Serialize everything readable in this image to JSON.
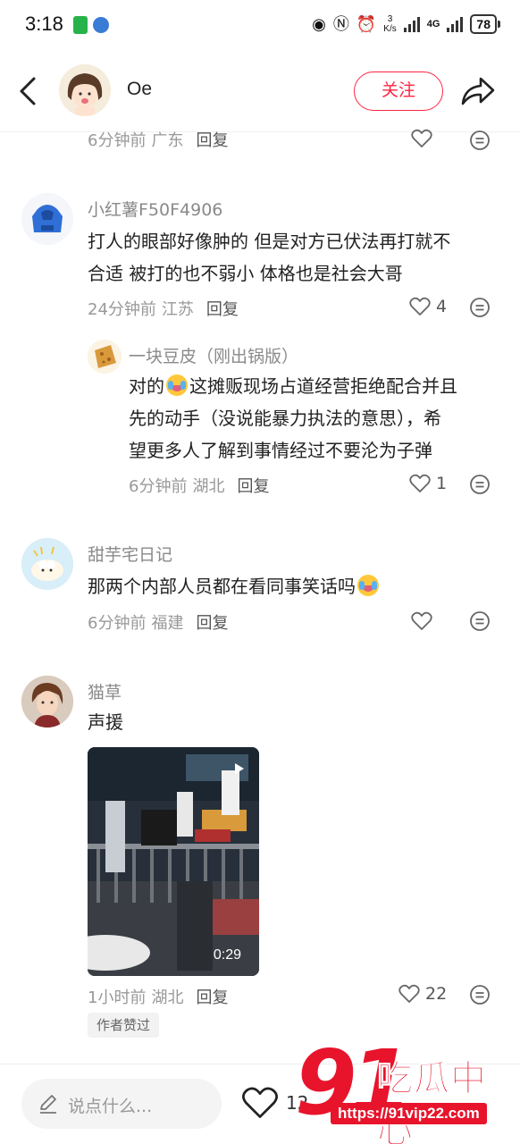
{
  "status_bar": {
    "time": "3:18",
    "net_speed_value": "3",
    "net_speed_unit": "K/s",
    "network": "4G",
    "battery": "78"
  },
  "header": {
    "name": "Oe",
    "follow_label": "关注"
  },
  "comments": [
    {
      "meta_time": "6分钟前",
      "meta_location": "广东",
      "reply_label": "回复",
      "likes": ""
    },
    {
      "username": "小红薯F50F4906",
      "content_line1": "打人的眼部好像肿的  但是对方已伏法再打就不",
      "content_line2": "合适  被打的也不弱小  体格也是社会大哥",
      "meta_time": "24分钟前",
      "meta_location": "江苏",
      "reply_label": "回复",
      "likes": "4",
      "sub_reply": {
        "username": "一块豆皮（刚出锅版）",
        "content_pre": "对的",
        "content_post": "这摊贩现场占道经营拒绝配合并且",
        "content_line2": "先的动手（没说能暴力执法的意思），希",
        "content_line3": "望更多人了解到事情经过不要沦为子弹",
        "meta_time": "6分钟前",
        "meta_location": "湖北",
        "reply_label": "回复",
        "likes": "1"
      }
    },
    {
      "username": "甜芋宅日记",
      "content": "那两个内部人员都在看同事笑话吗",
      "meta_time": "6分钟前",
      "meta_location": "福建",
      "reply_label": "回复",
      "likes": ""
    },
    {
      "username": "猫草",
      "content": "声援",
      "video_duration": "0:29",
      "meta_time": "1小时前",
      "meta_location": "湖北",
      "reply_label": "回复",
      "likes": "22",
      "author_liked_badge": "作者赞过"
    }
  ],
  "bottom_bar": {
    "input_placeholder": "说点什么...",
    "likes": "12"
  },
  "watermark": {
    "number": "91",
    "brand": "吃瓜中心",
    "url": "https://91vip22.com"
  },
  "colors": {
    "accent": "#ff2442",
    "meta_text": "#999999",
    "watermark": "#e8142c"
  }
}
